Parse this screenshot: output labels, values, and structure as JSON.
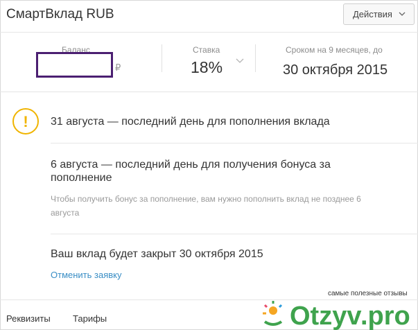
{
  "header": {
    "title": "СмартВклад RUB",
    "actions_label": "Действия"
  },
  "stats": {
    "balance_label": "Баланс",
    "currency_symbol": "₽",
    "rate_label": "Ставка",
    "rate_value": "18%",
    "term_label": "Сроком на 9 месяцев, до",
    "term_date": "30 октября 2015"
  },
  "notices": {
    "n1": "31 августа — последний день для пополнения вклада",
    "n2_line1": "6 августа — последний день для получения бонуса за",
    "n2_line2": "пополнение",
    "n2_sub_line1": "Чтобы получить бонус за пополнение, вам нужно пополнить вклад не позднее 6",
    "n2_sub_line2": "августа",
    "n3": "Ваш вклад будет закрыт 30 октября 2015",
    "cancel_link": "Отменить заявку"
  },
  "footer": {
    "details": "Реквизиты",
    "tariffs": "Тарифы"
  },
  "watermark": {
    "caption": "самые полезные отзывы",
    "logo_text": "Otzyv.pro"
  },
  "colors": {
    "accent_link": "#3a8ec5",
    "warning": "#f0b400",
    "redaction_border": "#4b1f71",
    "watermark_green": "#3fa34d"
  }
}
